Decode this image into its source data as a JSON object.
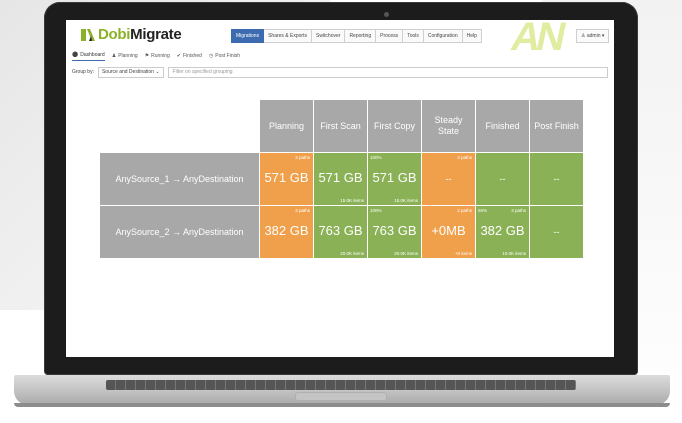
{
  "app": {
    "logo_text": "DobiMigrate",
    "logo_prefix": "Dobi",
    "logo_suffix": "Migrate",
    "accent": "#8bb12a",
    "brand_blue": "#3d6bb0"
  },
  "nav": {
    "items": [
      "Migrations",
      "Shares & Exports",
      "Switchover",
      "Reporting",
      "Process",
      "Tools",
      "Configuration",
      "Help"
    ],
    "active": "Migrations",
    "user": "admin"
  },
  "subnav": {
    "items": [
      {
        "label": "Dashboard",
        "icon": "dashboard-icon"
      },
      {
        "label": "Planning",
        "icon": "planning-icon"
      },
      {
        "label": "Running",
        "icon": "flag-icon"
      },
      {
        "label": "Finished",
        "icon": "check-icon"
      },
      {
        "label": "Post Finish",
        "icon": "clock-icon"
      }
    ]
  },
  "toolbar": {
    "group_by_label": "Group by:",
    "group_by_value": "Source and Destination",
    "filter_placeholder": "Filter on specified grouping"
  },
  "table": {
    "columns": [
      "Planning",
      "First Scan",
      "First Copy",
      "Steady State",
      "Finished",
      "Post Finish"
    ],
    "rows": [
      {
        "label": "AnySource_1 → AnyDestination",
        "cells": [
          {
            "value": "571 GB",
            "tr": "3 paths",
            "tl": "",
            "br": "",
            "color": "orange"
          },
          {
            "value": "571 GB",
            "tr": "",
            "tl": "",
            "br": "15.0K items",
            "color": "green"
          },
          {
            "value": "571 GB",
            "tr": "",
            "tl": "100%",
            "br": "15.0K items",
            "color": "green"
          },
          {
            "value": "--",
            "tr": "3 paths",
            "tl": "",
            "br": "",
            "color": "orange"
          },
          {
            "value": "--",
            "tr": "",
            "tl": "",
            "br": "",
            "color": "green"
          },
          {
            "value": "--",
            "tr": "",
            "tl": "",
            "br": "",
            "color": "green"
          }
        ]
      },
      {
        "label": "AnySource_2 → AnyDestination",
        "cells": [
          {
            "value": "382 GB",
            "tr": "3 paths",
            "tl": "",
            "br": "",
            "color": "orange"
          },
          {
            "value": "763 GB",
            "tr": "",
            "tl": "",
            "br": "20.0K items",
            "color": "green"
          },
          {
            "value": "763 GB",
            "tr": "",
            "tl": "100%",
            "br": "20.0K items",
            "color": "green"
          },
          {
            "value": "+0MB",
            "tr": "2 paths",
            "tl": "",
            "br": "+0 items",
            "color": "orange"
          },
          {
            "value": "382 GB",
            "tr": "3 paths",
            "tl": "50%",
            "br": "10.0K items",
            "color": "green"
          },
          {
            "value": "--",
            "tr": "",
            "tl": "",
            "br": "",
            "color": "green"
          }
        ]
      }
    ]
  },
  "colors": {
    "orange": "#f0a04b",
    "green": "#8ab155",
    "header_gray": "#a8a8a8"
  }
}
